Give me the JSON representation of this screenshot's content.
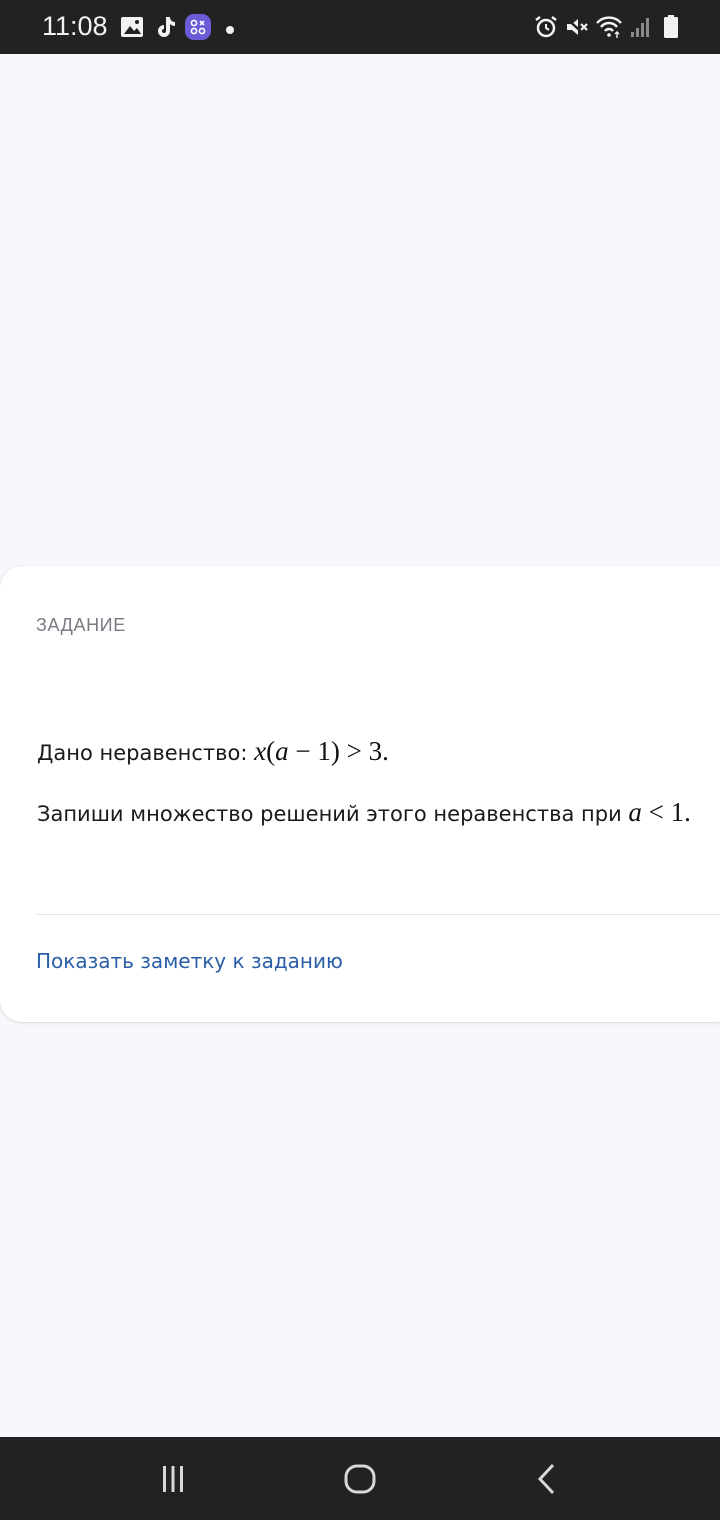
{
  "status_bar": {
    "time": "11:08",
    "icons": [
      "gallery-icon",
      "tiktok-icon",
      "app-badge-icon",
      "dot-icon",
      "alarm-icon",
      "mute-icon",
      "wifi-icon",
      "signal-icon",
      "battery-icon"
    ],
    "badge_color": "#6b5bd6"
  },
  "task_card": {
    "label": "ЗАДАНИЕ",
    "line1_text": "Дано неравенство: ",
    "line1_math": {
      "x": "x",
      "open": "(",
      "a": "a",
      "rest": " − 1) > 3."
    },
    "line2_text": "Запиши множество решений этого неравенства при ",
    "line2_math": {
      "a": "a",
      "rest": " < 1."
    },
    "note_link": "Показать заметку к заданию"
  },
  "nav_bar": {
    "buttons": [
      "recent-apps-icon",
      "home-icon",
      "back-icon"
    ]
  },
  "colors": {
    "background": "#f7f8fc",
    "card": "#ffffff",
    "link": "#2a5ea8",
    "system_bars": "#222222"
  }
}
